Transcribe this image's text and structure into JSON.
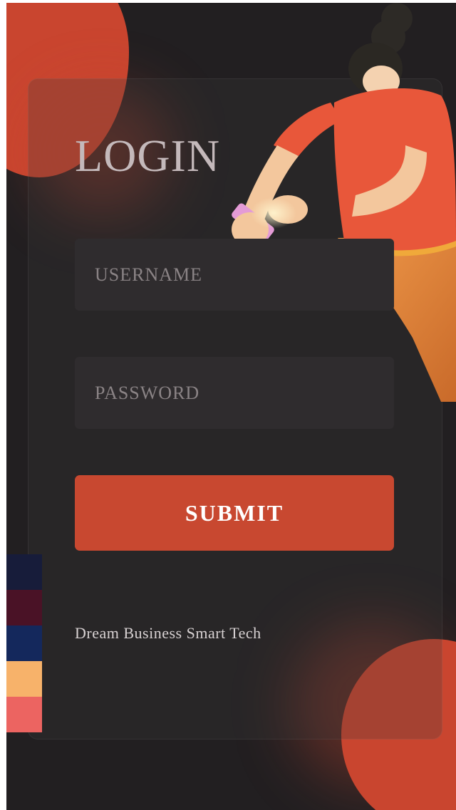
{
  "login": {
    "title": "LOGIN",
    "username_placeholder": "USERNAME",
    "password_placeholder": "PASSWORD",
    "submit_label": "SUBMIT"
  },
  "footer": {
    "tagline": "Dream Business Smart Tech"
  },
  "theme": {
    "background": "#221f21",
    "accent": "#c84830",
    "field_bg": "#2f2c2e",
    "title_color": "#c4b9bb"
  },
  "palette_swatches": [
    "#171c3a",
    "#4a1226",
    "#14285c",
    "#f7b26a",
    "#ec6461"
  ]
}
